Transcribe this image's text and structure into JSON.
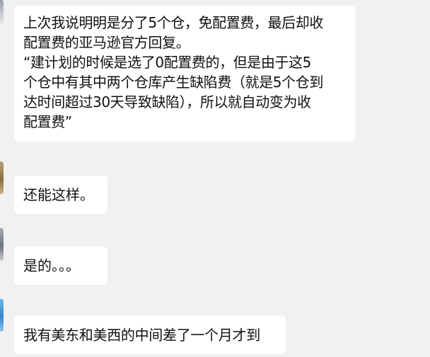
{
  "messages": [
    {
      "lines": [
        "上次我说明明是分了5个仓，免配置费，最后却收",
        "配置费的亚马逊官方回复。",
        "“建计划的时候是选了0配置费的，但是由于这5",
        "个仓中有其中两个仓库产生缺陷费（就是5个仓到",
        "达时间超过30天导致缺陷），所以就自动变为收",
        "配置费”"
      ]
    },
    {
      "lines": [
        "还能这样。"
      ]
    },
    {
      "lines": [
        "是的。。。"
      ]
    },
    {
      "lines": [
        "我有美东和美西的中间差了一个月才到"
      ]
    }
  ]
}
